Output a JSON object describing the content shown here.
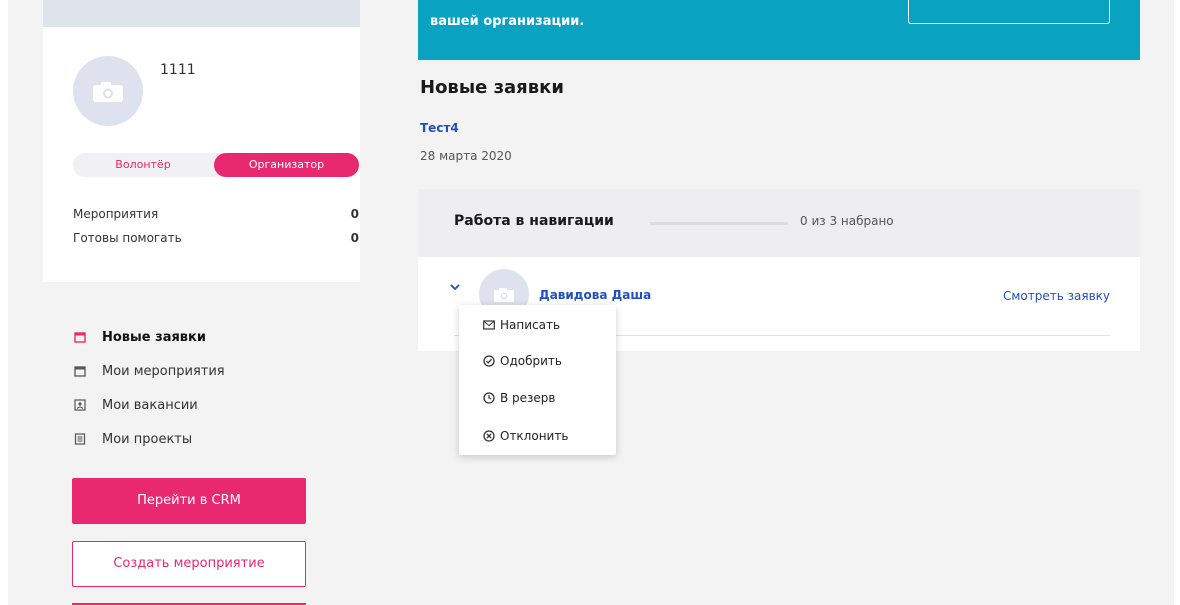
{
  "profile": {
    "name": "1111",
    "roles": {
      "volunteer": "Волонтёр",
      "organizer": "Организатор",
      "active": "organizer"
    },
    "stats": [
      {
        "label": "Мероприятия",
        "value": "0"
      },
      {
        "label": "Готовы помогать",
        "value": "0"
      }
    ]
  },
  "sidebar": {
    "items": [
      {
        "label": "Новые заявки",
        "icon": "calendar-icon",
        "active": true
      },
      {
        "label": "Мои мероприятия",
        "icon": "calendar-icon",
        "active": false
      },
      {
        "label": "Мои вакансии",
        "icon": "person-badge-icon",
        "active": false
      },
      {
        "label": "Мои проекты",
        "icon": "document-icon",
        "active": false
      }
    ],
    "crm_button": "Перейти в CRM",
    "create_event_button": "Создать мероприятие"
  },
  "banner": {
    "text": "вашей организации."
  },
  "main": {
    "title": "Новые заявки",
    "event": {
      "title": "Тест4",
      "date": "28 марта 2020"
    },
    "vacancy": {
      "title": "Работа в навигации",
      "progress_fraction": 0,
      "progress_text": "0 из 3 набрано",
      "applicant": {
        "name": "Давидова Даша",
        "view_link": "Смотреть заявку"
      }
    }
  },
  "dropdown": {
    "items": [
      {
        "label": "Написать",
        "icon": "mail-icon"
      },
      {
        "label": "Одобрить",
        "icon": "check-circle-icon"
      },
      {
        "label": "В резерв",
        "icon": "clock-icon"
      },
      {
        "label": "Отклонить",
        "icon": "x-circle-icon"
      }
    ]
  },
  "colors": {
    "accent": "#e8286f",
    "banner": "#0aa2c1",
    "link": "#1f4fc0"
  }
}
